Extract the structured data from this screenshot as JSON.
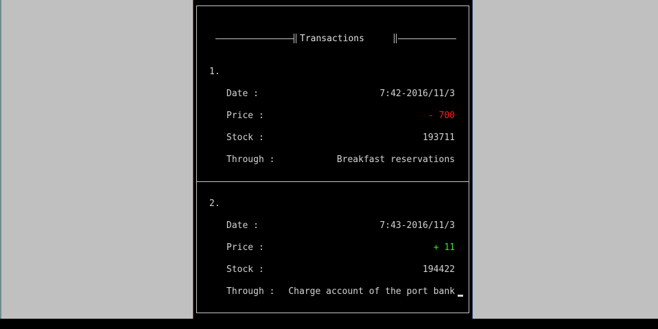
{
  "header": {
    "title": "Transactions"
  },
  "transactions": [
    {
      "number": "1.",
      "date_label": "Date :",
      "date": "7:42-2016/11/3",
      "price_label": "Price :",
      "price": "- 700",
      "price_sign": "negative",
      "stock_label": "Stock :",
      "stock": "193711",
      "through_label": "Through :",
      "through": "Breakfast reservations"
    },
    {
      "number": "2.",
      "date_label": "Date :",
      "date": "7:43-2016/11/3",
      "price_label": "Price :",
      "price": "+ 11",
      "price_sign": "positive",
      "stock_label": "Stock :",
      "stock": "194422",
      "through_label": "Through :",
      "through": "Charge account of the port bank"
    }
  ],
  "colors": {
    "negative": "#ff1a1a",
    "positive": "#2ce82c",
    "text": "#d4d4d4",
    "background": "#000000",
    "desktop": "#c0c0c0"
  }
}
